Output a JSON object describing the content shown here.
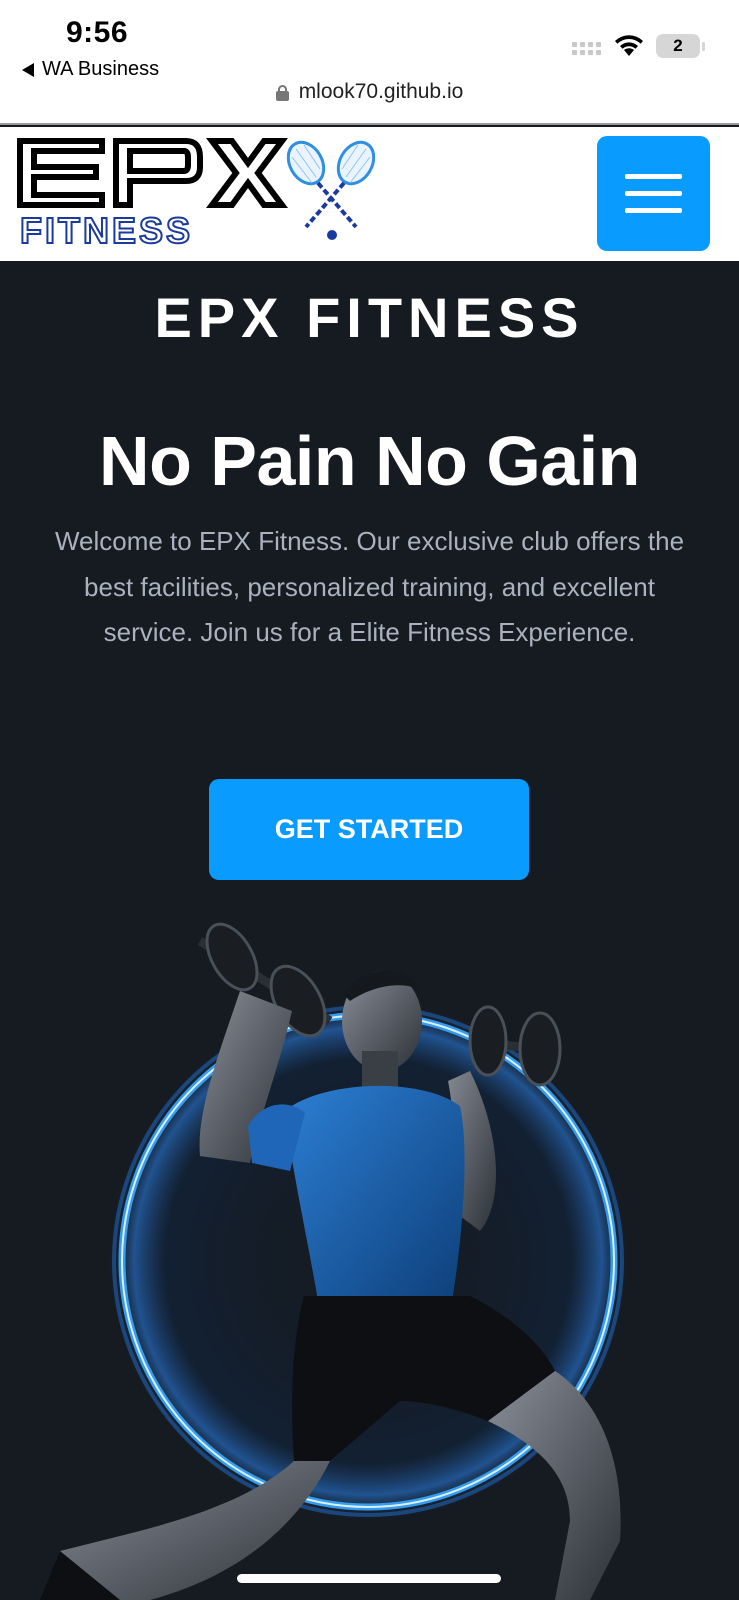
{
  "status_bar": {
    "time": "9:56",
    "back_app": "WA Business",
    "battery": "2"
  },
  "browser": {
    "url": "mlook70.github.io"
  },
  "header": {
    "logo_letters": "EPX",
    "logo_subtext": "FITNESS",
    "menu_icon": "hamburger-icon"
  },
  "hero": {
    "brand": "EPX FITNESS",
    "headline": "No Pain No Gain",
    "intro": "Welcome to EPX Fitness. Our exclusive club offers the best facilities, personalized training, and excellent service. Join us for a Elite Fitness Experience.",
    "cta_label": "GET STARTED"
  },
  "colors": {
    "accent": "#0a9bff",
    "hero_background": "#161b22",
    "intro_text": "#a9b2bd",
    "glow_ring": "#3aa8ff"
  }
}
